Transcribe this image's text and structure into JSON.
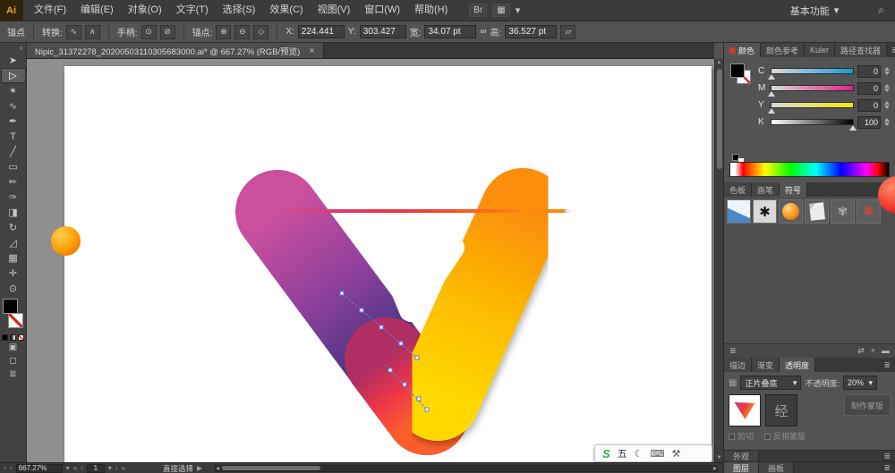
{
  "menu_bar": {
    "logo_text": "Ai",
    "items": [
      "文件(F)",
      "编辑(E)",
      "对象(O)",
      "文字(T)",
      "选择(S)",
      "效果(C)",
      "视图(V)",
      "窗口(W)",
      "帮助(H)"
    ],
    "bridge_label": "Br",
    "arrange_icon": "▦",
    "arrange_caret": "▾",
    "workspace_label": "基本功能",
    "workspace_caret": "▾",
    "search_icon": "⌕"
  },
  "control_bar": {
    "tool_label": "锚点",
    "convert_label": "转换:",
    "convert_icons": [
      "∿",
      "∧"
    ],
    "handles_label": "手柄:",
    "handle_icons": [
      "⊙",
      "⊘"
    ],
    "anchors_label": "锚点:",
    "anchor_icons": [
      "⊕",
      "⊖",
      "◇"
    ],
    "x_label": "X:",
    "x_value": "224.441",
    "y_label": "Y:",
    "y_value": "303.427",
    "w_label": "宽:",
    "w_value": "34.07 pt",
    "link_icon": "∞",
    "h_label": "高:",
    "h_value": "36.527 pt",
    "transform_icon": "▱"
  },
  "document_tab": {
    "title": "Nipic_31372278_20200503110305683000.ai* @ 667.27% (RGB/预览)",
    "close_icon": "×"
  },
  "toolbar": {
    "collapse_icon": "«",
    "tools": [
      {
        "name": "selection",
        "glyph": "➤"
      },
      {
        "name": "direct-selection",
        "glyph": "▷"
      },
      {
        "name": "magic-wand",
        "glyph": "✶"
      },
      {
        "name": "lasso",
        "glyph": "∿"
      },
      {
        "name": "pen",
        "glyph": "✒"
      },
      {
        "name": "type",
        "glyph": "T"
      },
      {
        "name": "line",
        "glyph": "╱"
      },
      {
        "name": "rectangle",
        "glyph": "▭"
      },
      {
        "name": "pencil",
        "glyph": "✏"
      },
      {
        "name": "paintbrush",
        "glyph": "✑"
      },
      {
        "name": "eraser",
        "glyph": "◨"
      },
      {
        "name": "rotate",
        "glyph": "↻"
      },
      {
        "name": "scale",
        "glyph": "◿"
      },
      {
        "name": "mesh",
        "glyph": "▦"
      },
      {
        "name": "hand",
        "glyph": "✛"
      },
      {
        "name": "zoom",
        "glyph": "⊙"
      }
    ],
    "mode_icons": [
      "▣",
      "◻",
      "≣"
    ]
  },
  "panels": {
    "color_group": {
      "tabs": [
        "颜色",
        "颜色参考",
        "Kuler",
        "路径查找器"
      ],
      "menu_icon": "≣",
      "sliders": [
        {
          "label": "C",
          "value": "0"
        },
        {
          "label": "M",
          "value": "0"
        },
        {
          "label": "Y",
          "value": "0"
        },
        {
          "label": "K",
          "value": "100"
        }
      ]
    },
    "symbols_group": {
      "tabs": [
        "色板",
        "画笔",
        "符号"
      ],
      "menu_icon": "≣",
      "glyphs": {
        "splat": "✱",
        "gear": "✾",
        "flower": "❁"
      },
      "footer_icons": [
        "≣",
        "⇄",
        "+",
        "▬"
      ]
    },
    "transparency_group": {
      "tabs": [
        "描边",
        "渐变",
        "透明度"
      ],
      "menu_icon": "≣",
      "grid_icon": "▦",
      "blend_mode": "正片叠底",
      "dd_caret": "▾",
      "opacity_label": "不透明度:",
      "opacity_value": "20%",
      "mask_thumb_text": "经",
      "make_mask_label": "制作蒙版",
      "clip_label": "剪切",
      "invert_label": "反相蒙版"
    },
    "appearance_tab": "外观",
    "bottom_tabs": [
      "图层",
      "画板"
    ],
    "bottom_menu_icon": "≣"
  },
  "status_bar": {
    "win_icons": [
      "▫",
      "▫"
    ],
    "zoom_value": "667.27%",
    "zoom_caret": "▾",
    "nav_first": "«",
    "nav_prev": "‹",
    "artboard_value": "1",
    "artboard_caret": "▾",
    "nav_next": "›",
    "nav_last": "»",
    "tool_status": "直接选择",
    "flyout_icon": "▶"
  },
  "scrollbars": {
    "up": "▲",
    "down": "▼",
    "left": "◂",
    "right": "▸"
  },
  "ime_bar": {
    "items": [
      {
        "name": "sogou-logo",
        "glyph": "S"
      },
      {
        "name": "wubi-indicator",
        "glyph": "五"
      },
      {
        "name": "moon-icon",
        "glyph": "☾"
      },
      {
        "name": "keyboard-icon",
        "glyph": "⌨"
      },
      {
        "name": "wrench-icon",
        "glyph": "⚒"
      }
    ]
  },
  "artwork": {
    "grad_top": [
      "#c94f9e",
      "#e03a5d",
      "#ee3744",
      "#f75c22",
      "#fb8a10"
    ],
    "grad_left": [
      "#cb4f9f",
      "#8a3f9b",
      "#4b3584",
      "#27306c"
    ],
    "grad_right": [
      "#fb8e08",
      "#fdbe04",
      "#ffd904"
    ],
    "grad_tip": [
      "#b12e62",
      "#ee3747",
      "#fb5e2a"
    ],
    "hole_color": "#ffffff",
    "selection_color": "#5b7fe8",
    "pasteboard_sphere_color": "#fe9b00",
    "floating_sphere_color": "#f1392e"
  }
}
